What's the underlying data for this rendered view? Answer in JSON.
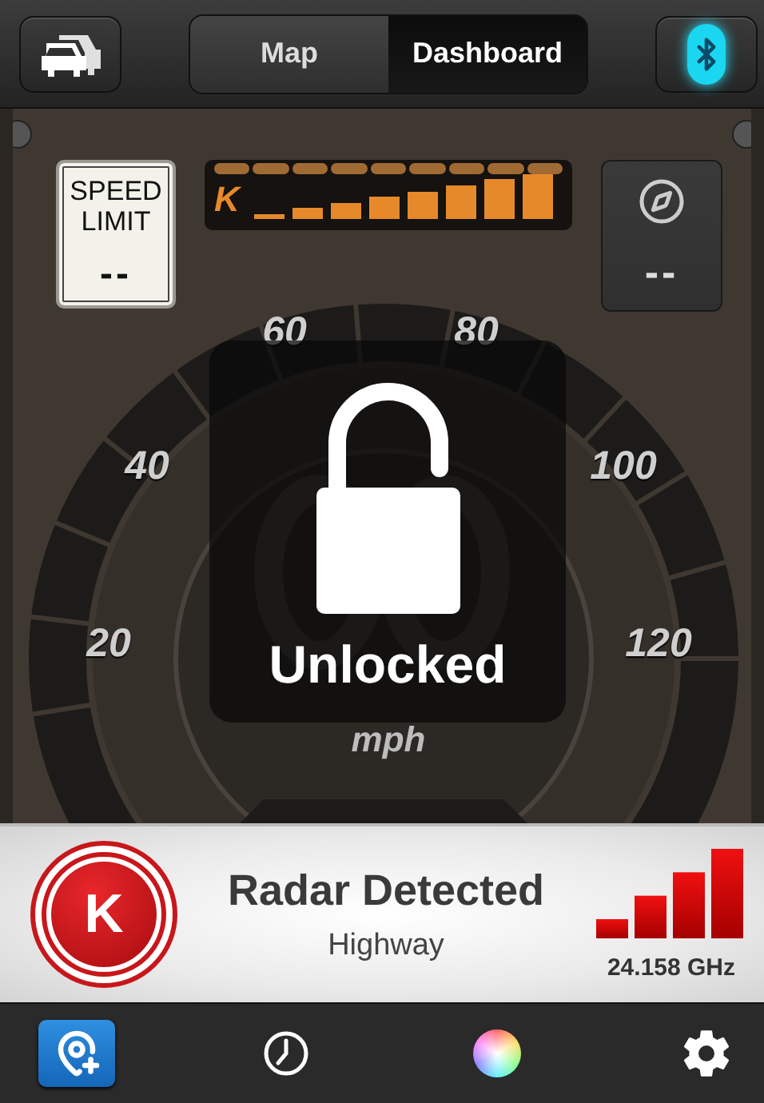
{
  "top_bar": {
    "segments": [
      {
        "label": "Map",
        "selected": false
      },
      {
        "label": "Dashboard",
        "selected": true
      }
    ],
    "bluetooth": {
      "on": true
    }
  },
  "speed_limit": {
    "label": "SPEED LIMIT",
    "value": "--"
  },
  "signal_meter": {
    "band": "K"
  },
  "compass": {
    "value": "--"
  },
  "speedometer": {
    "scale": [
      "20",
      "40",
      "60",
      "80",
      "100",
      "120"
    ],
    "unit": "mph"
  },
  "lock_overlay": {
    "status": "Unlocked"
  },
  "alert": {
    "band": "K",
    "title": "Radar Detected",
    "subtitle": "Highway",
    "frequency": "24.158 GHz"
  },
  "tab_bar": [
    {
      "kind": "add-location",
      "selected": true
    },
    {
      "kind": "history",
      "selected": false
    },
    {
      "kind": "color",
      "selected": false
    },
    {
      "kind": "settings",
      "selected": false
    }
  ]
}
